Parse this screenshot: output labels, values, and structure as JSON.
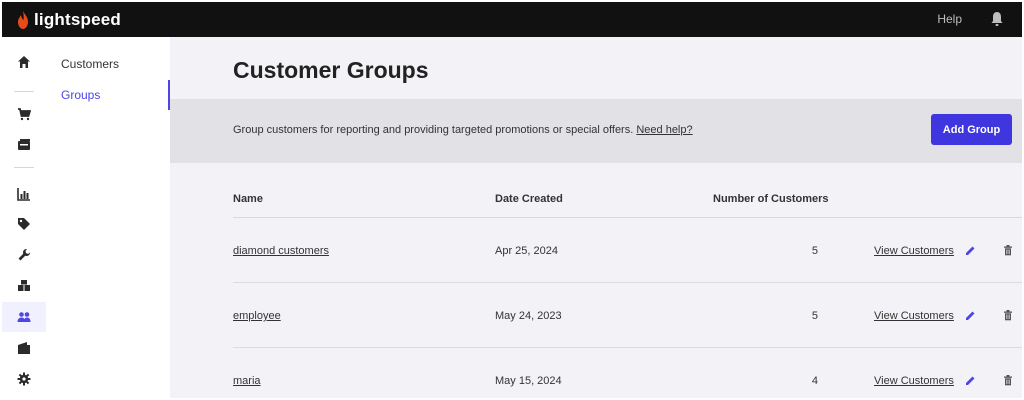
{
  "brand": {
    "name": "lightspeed",
    "accent": "#e64a19"
  },
  "topbar": {
    "help_label": "Help",
    "bell_icon": "bell-icon"
  },
  "rail": {
    "items": [
      "home-icon",
      "cart-icon",
      "register-icon",
      "reports-icon",
      "tag-icon",
      "wrench-icon",
      "inventory-icon",
      "customers-icon",
      "wallet-icon",
      "gear-icon"
    ],
    "active": "customers-icon",
    "active_color": "#4f45e4"
  },
  "subnav": {
    "items": [
      {
        "label": "Customers"
      },
      {
        "label": "Groups"
      }
    ],
    "active_index": 1
  },
  "main": {
    "title": "Customer Groups",
    "banner": {
      "description": "Group customers for reporting and providing targeted promotions or special offers.",
      "help_link": "Need help?",
      "add_button": "Add Group"
    },
    "table": {
      "columns": [
        "Name",
        "Date Created",
        "Number of Customers"
      ],
      "rows": [
        {
          "name": "diamond customers",
          "date": "Apr 25, 2024",
          "count": "5",
          "view": "View Customers"
        },
        {
          "name": "employee",
          "date": "May 24, 2023",
          "count": "5",
          "view": "View Customers"
        },
        {
          "name": "maria",
          "date": "May 15, 2024",
          "count": "4",
          "view": "View Customers"
        }
      ]
    }
  }
}
